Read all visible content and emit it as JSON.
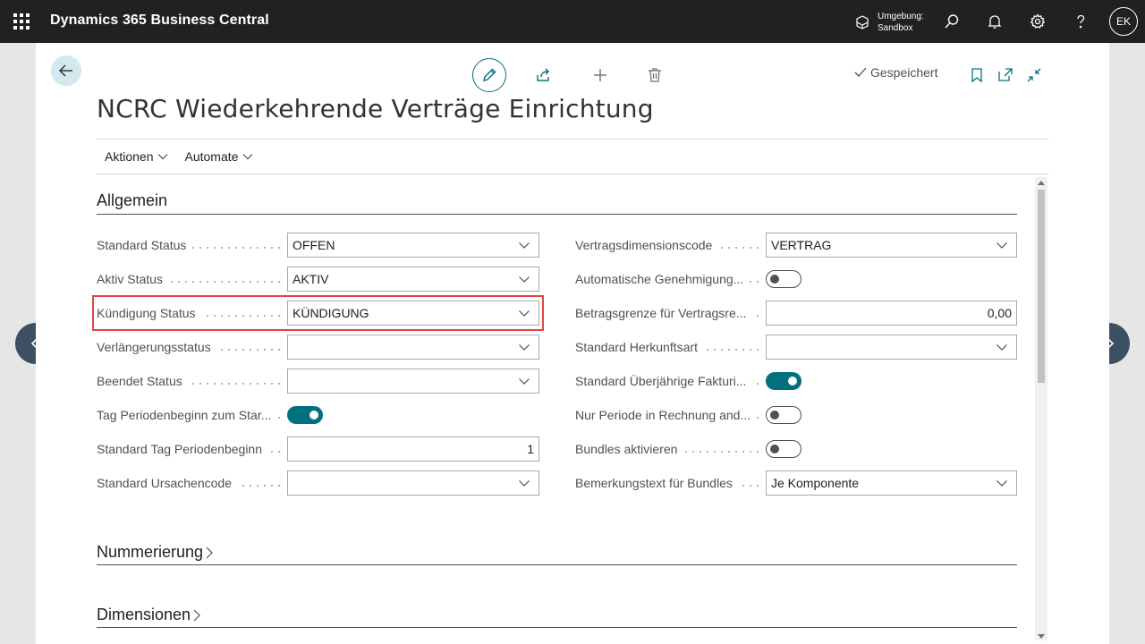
{
  "topbar": {
    "app_title": "Dynamics 365 Business Central",
    "env_label": "Umgebung:",
    "env_value": "Sandbox",
    "avatar_initials": "EK"
  },
  "actions": {
    "saved_label": "Gespeichert"
  },
  "page": {
    "title": "NCRC Wiederkehrende Verträge Einrichtung"
  },
  "menu": {
    "items": [
      {
        "label": "Aktionen"
      },
      {
        "label": "Automate"
      }
    ]
  },
  "sections": {
    "general": "Allgemein",
    "numbering": "Nummerierung",
    "dimensions": "Dimensionen"
  },
  "left_fields": [
    {
      "label": "Standard Status",
      "type": "select",
      "value": "OFFEN"
    },
    {
      "label": "Aktiv Status",
      "type": "select",
      "value": "AKTIV"
    },
    {
      "label": "Kündigung Status",
      "type": "select",
      "value": "KÜNDIGUNG"
    },
    {
      "label": "Verlängerungsstatus",
      "type": "select",
      "value": ""
    },
    {
      "label": "Beendet Status",
      "type": "select",
      "value": ""
    },
    {
      "label": "Tag Periodenbeginn zum Star...",
      "type": "toggle",
      "value": "on"
    },
    {
      "label": "Standard Tag Periodenbeginn",
      "type": "number",
      "value": "1"
    },
    {
      "label": "Standard Ursachencode",
      "type": "select",
      "value": ""
    }
  ],
  "right_fields": [
    {
      "label": "Vertragsdimensionscode",
      "type": "select",
      "value": "VERTRAG"
    },
    {
      "label": "Automatische Genehmigung...",
      "type": "toggle",
      "value": "off"
    },
    {
      "label": "Betragsgrenze für Vertragsre...",
      "type": "number",
      "value": "0,00"
    },
    {
      "label": "Standard Herkunftsart",
      "type": "select",
      "value": ""
    },
    {
      "label": "Standard Überjährige Fakturi...",
      "type": "toggle",
      "value": "on"
    },
    {
      "label": "Nur Periode in Rechnung and...",
      "type": "toggle",
      "value": "off"
    },
    {
      "label": "Bundles aktivieren",
      "type": "toggle",
      "value": "off"
    },
    {
      "label": "Bemerkungstext für Bundles",
      "type": "select",
      "value": "Je Komponente"
    }
  ],
  "colors": {
    "topbar": "#212121",
    "accent": "#00707f",
    "highlight": "#e04444",
    "nav_circle": "#3d4f63"
  }
}
